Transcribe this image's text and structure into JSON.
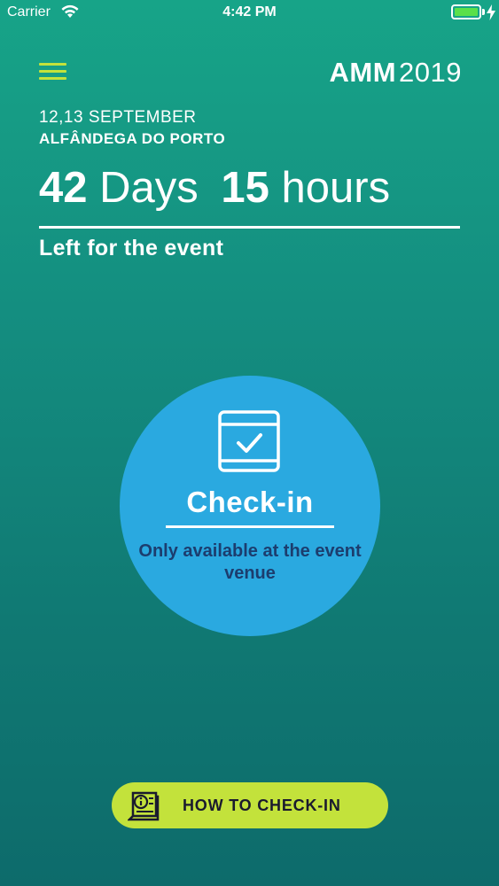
{
  "status_bar": {
    "carrier": "Carrier",
    "time": "4:42 PM"
  },
  "header": {
    "logo_bold": "AMM",
    "logo_year": "2019",
    "menu_icon": "hamburger-menu-icon"
  },
  "event": {
    "dates": "12,13 SEPTEMBER",
    "venue": "ALFÂNDEGA DO PORTO"
  },
  "countdown": {
    "days_value": "42",
    "days_unit": "Days",
    "hours_value": "15",
    "hours_unit": "hours",
    "caption": "Left for the event"
  },
  "checkin": {
    "icon": "calendar-check-icon",
    "label": "Check-in",
    "note": "Only available at the event venue"
  },
  "how_to": {
    "icon": "info-book-icon",
    "label": "HOW TO CHECK-IN"
  },
  "colors": {
    "accent_lime": "#c3e23b",
    "circle_blue": "#2aa9e0",
    "note_navy": "#1c3d6e",
    "bg_top": "#17a488",
    "bg_bottom": "#0d6b6b"
  }
}
